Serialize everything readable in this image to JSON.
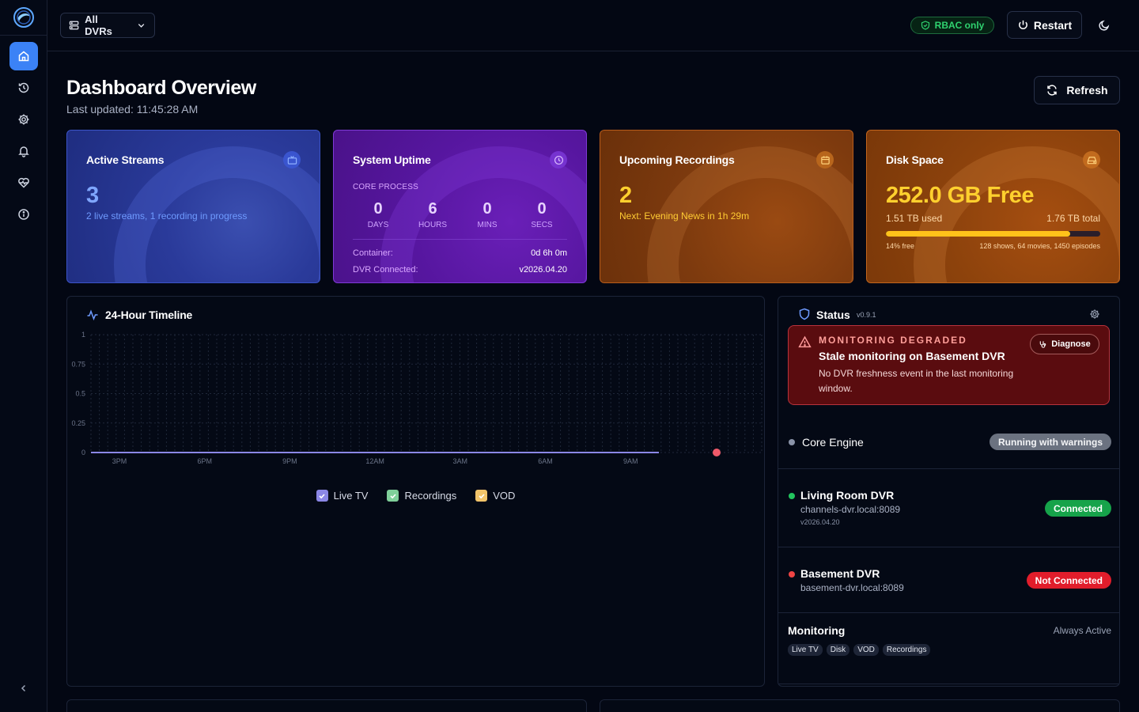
{
  "topbar": {
    "dvr_select": "All DVRs",
    "rbac": "RBAC only",
    "restart": "Restart"
  },
  "header": {
    "title": "Dashboard Overview",
    "last_updated": "Last updated: 11:45:28 AM",
    "refresh": "Refresh"
  },
  "cards": {
    "streams": {
      "title": "Active Streams",
      "value": "3",
      "sub": "2 live streams, 1 recording in progress"
    },
    "uptime": {
      "title": "System Uptime",
      "label": "CORE PROCESS",
      "units": [
        {
          "value": "0",
          "label": "DAYS"
        },
        {
          "value": "6",
          "label": "HOURS"
        },
        {
          "value": "0",
          "label": "MINS"
        },
        {
          "value": "0",
          "label": "SECS"
        }
      ],
      "container_label": "Container:",
      "container_value": "0d 6h 0m",
      "dvr_label": "DVR Connected:",
      "dvr_value": "v2026.04.20"
    },
    "upcoming": {
      "title": "Upcoming Recordings",
      "value": "2",
      "sub": "Next: Evening News in 1h 29m"
    },
    "disk": {
      "title": "Disk Space",
      "value": "252.0 GB Free",
      "used": "1.51 TB used",
      "total": "1.76 TB total",
      "used_fraction": 0.86,
      "free": "14% free",
      "counts": "128 shows, 64 movies, 1450 episodes"
    }
  },
  "timeline": {
    "title": "24-Hour Timeline",
    "legend": [
      {
        "label": "Live TV",
        "color": "#8b87e6"
      },
      {
        "label": "Recordings",
        "color": "#7fcf9a"
      },
      {
        "label": "VOD",
        "color": "#f2c46a"
      }
    ]
  },
  "chart_data": {
    "type": "line",
    "title": "24-Hour Timeline",
    "x_ticks": [
      "3PM",
      "6PM",
      "9PM",
      "12AM",
      "3AM",
      "6AM",
      "9AM"
    ],
    "y_ticks": [
      "0",
      "0.25",
      "0.5",
      "0.75",
      "1"
    ],
    "ylim": [
      0,
      1
    ],
    "series": [
      {
        "name": "Live TV",
        "values": [
          0,
          0,
          0,
          0,
          0,
          0,
          0
        ],
        "color": "#8b87e6"
      },
      {
        "name": "Recordings",
        "values": [
          0,
          0,
          0,
          0,
          0,
          0,
          0
        ],
        "color": "#7fcf9a"
      },
      {
        "name": "VOD",
        "values": [
          0,
          0,
          0,
          0,
          0,
          0,
          0
        ],
        "color": "#f2c46a"
      }
    ],
    "grid": true
  },
  "status": {
    "title": "Status",
    "version": "v0.9.1",
    "alert": {
      "head": "MONITORING DEGRADED",
      "sub": "Stale monitoring on Basement DVR",
      "body": "No DVR freshness event in the last monitoring window.",
      "action": "Diagnose"
    },
    "core": {
      "name": "Core Engine",
      "state": "Running with warnings"
    },
    "dvrs": [
      {
        "name": "Living Room DVR",
        "host": "channels-dvr.local:8089",
        "version": "v2026.04.20",
        "state": "Connected"
      },
      {
        "name": "Basement DVR",
        "host": "basement-dvr.local:8089",
        "state": "Not Connected"
      }
    ],
    "monitoring": {
      "name": "Monitoring",
      "state": "Always Active",
      "tags": [
        "Live TV",
        "Disk",
        "VOD",
        "Recordings"
      ]
    }
  },
  "colors": {
    "accent": "#3b82f6",
    "success": "#16a34a",
    "danger": "#e11d2b",
    "warning": "#ffd02e"
  }
}
